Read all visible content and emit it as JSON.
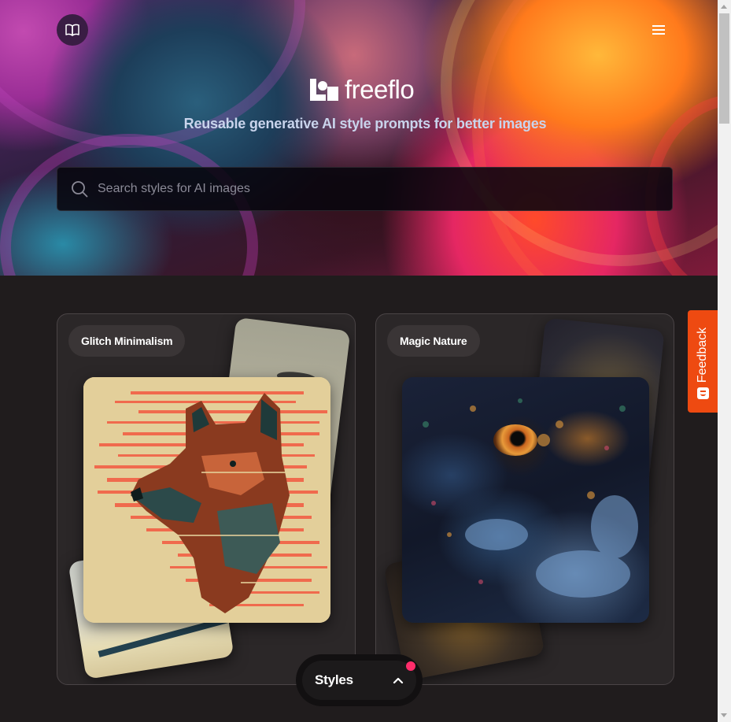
{
  "header": {
    "logo_text": "freeflo",
    "tagline": "Reusable generative AI style prompts for better images",
    "book_icon": "book-open-icon",
    "menu_icon": "hamburger-menu-icon"
  },
  "search": {
    "placeholder": "Search styles for AI images",
    "value": "",
    "icon": "search-icon"
  },
  "cards": [
    {
      "label": "Glitch Minimalism"
    },
    {
      "label": "Magic Nature"
    }
  ],
  "styles_dock": {
    "label": "Styles",
    "icon": "chevron-up-icon",
    "notification_color": "#ff2d6b"
  },
  "feedback": {
    "label": "Feedback",
    "icon": "feedback-smiley-icon",
    "color": "#ee4a11"
  }
}
